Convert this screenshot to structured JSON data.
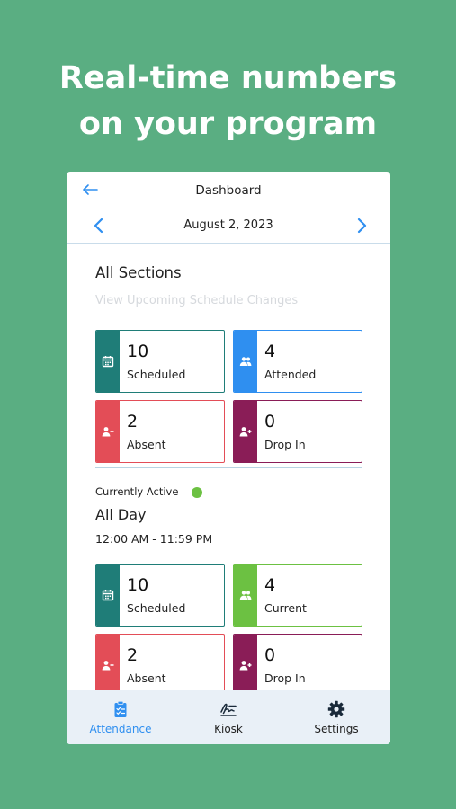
{
  "headline": {
    "line1": "Real-time numbers",
    "line2": "on your program"
  },
  "header": {
    "title": "Dashboard",
    "back_icon": "arrow-left-icon"
  },
  "date_nav": {
    "date": "August 2, 2023",
    "prev_icon": "chevron-left-icon",
    "next_icon": "chevron-right-icon"
  },
  "summary": {
    "title": "All Sections",
    "upcoming_link": "View Upcoming Schedule Changes",
    "cards": [
      {
        "value": "10",
        "label": "Scheduled",
        "icon": "calendar-icon",
        "color": "#1f7d78"
      },
      {
        "value": "4",
        "label": "Attended",
        "icon": "users-icon",
        "color": "#2f8ff0"
      },
      {
        "value": "2",
        "label": "Absent",
        "icon": "user-minus-icon",
        "color": "#e34d57"
      },
      {
        "value": "0",
        "label": "Drop In",
        "icon": "user-plus-icon",
        "color": "#8a1d57"
      }
    ]
  },
  "active": {
    "status_label": "Currently Active",
    "status_color": "#6cc142",
    "name": "All Day",
    "time": "12:00 AM - 11:59 PM",
    "cards": [
      {
        "value": "10",
        "label": "Scheduled",
        "icon": "calendar-icon",
        "color": "#1f7d78"
      },
      {
        "value": "4",
        "label": "Current",
        "icon": "users-icon",
        "color": "#6cc142"
      },
      {
        "value": "2",
        "label": "Absent",
        "icon": "user-minus-icon",
        "color": "#e34d57"
      },
      {
        "value": "0",
        "label": "Drop In",
        "icon": "user-plus-icon",
        "color": "#8a1d57"
      }
    ]
  },
  "tabs": [
    {
      "label": "Attendance",
      "icon": "clipboard-check-icon",
      "active": true
    },
    {
      "label": "Kiosk",
      "icon": "signature-icon",
      "active": false
    },
    {
      "label": "Settings",
      "icon": "gear-icon",
      "active": false
    }
  ],
  "colors": {
    "background": "#5aae82",
    "accent": "#2f8ff0",
    "tabbar": "#e9f0f7"
  }
}
